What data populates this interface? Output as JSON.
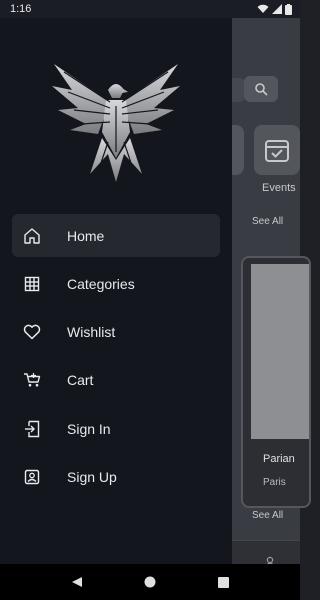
{
  "status": {
    "time": "1:16"
  },
  "drawer": {
    "menu": [
      {
        "label": "Home",
        "icon": "home-icon",
        "active": true
      },
      {
        "label": "Categories",
        "icon": "grid-icon",
        "active": false
      },
      {
        "label": "Wishlist",
        "icon": "heart-icon",
        "active": false
      },
      {
        "label": "Cart",
        "icon": "cart-icon",
        "active": false
      },
      {
        "label": "Sign In",
        "icon": "sign-in-icon",
        "active": false
      },
      {
        "label": "Sign Up",
        "icon": "sign-up-icon",
        "active": false
      }
    ]
  },
  "background": {
    "category_label": "Events",
    "see_all_1": "See All",
    "see_all_2": "See All",
    "card_title": "Parian",
    "card_subtitle": "Paris"
  },
  "colors": {
    "drawer_bg": "#14161e",
    "active_item_bg": "#262830",
    "text": "#e9eaee",
    "scrim": "#3a3c43"
  }
}
